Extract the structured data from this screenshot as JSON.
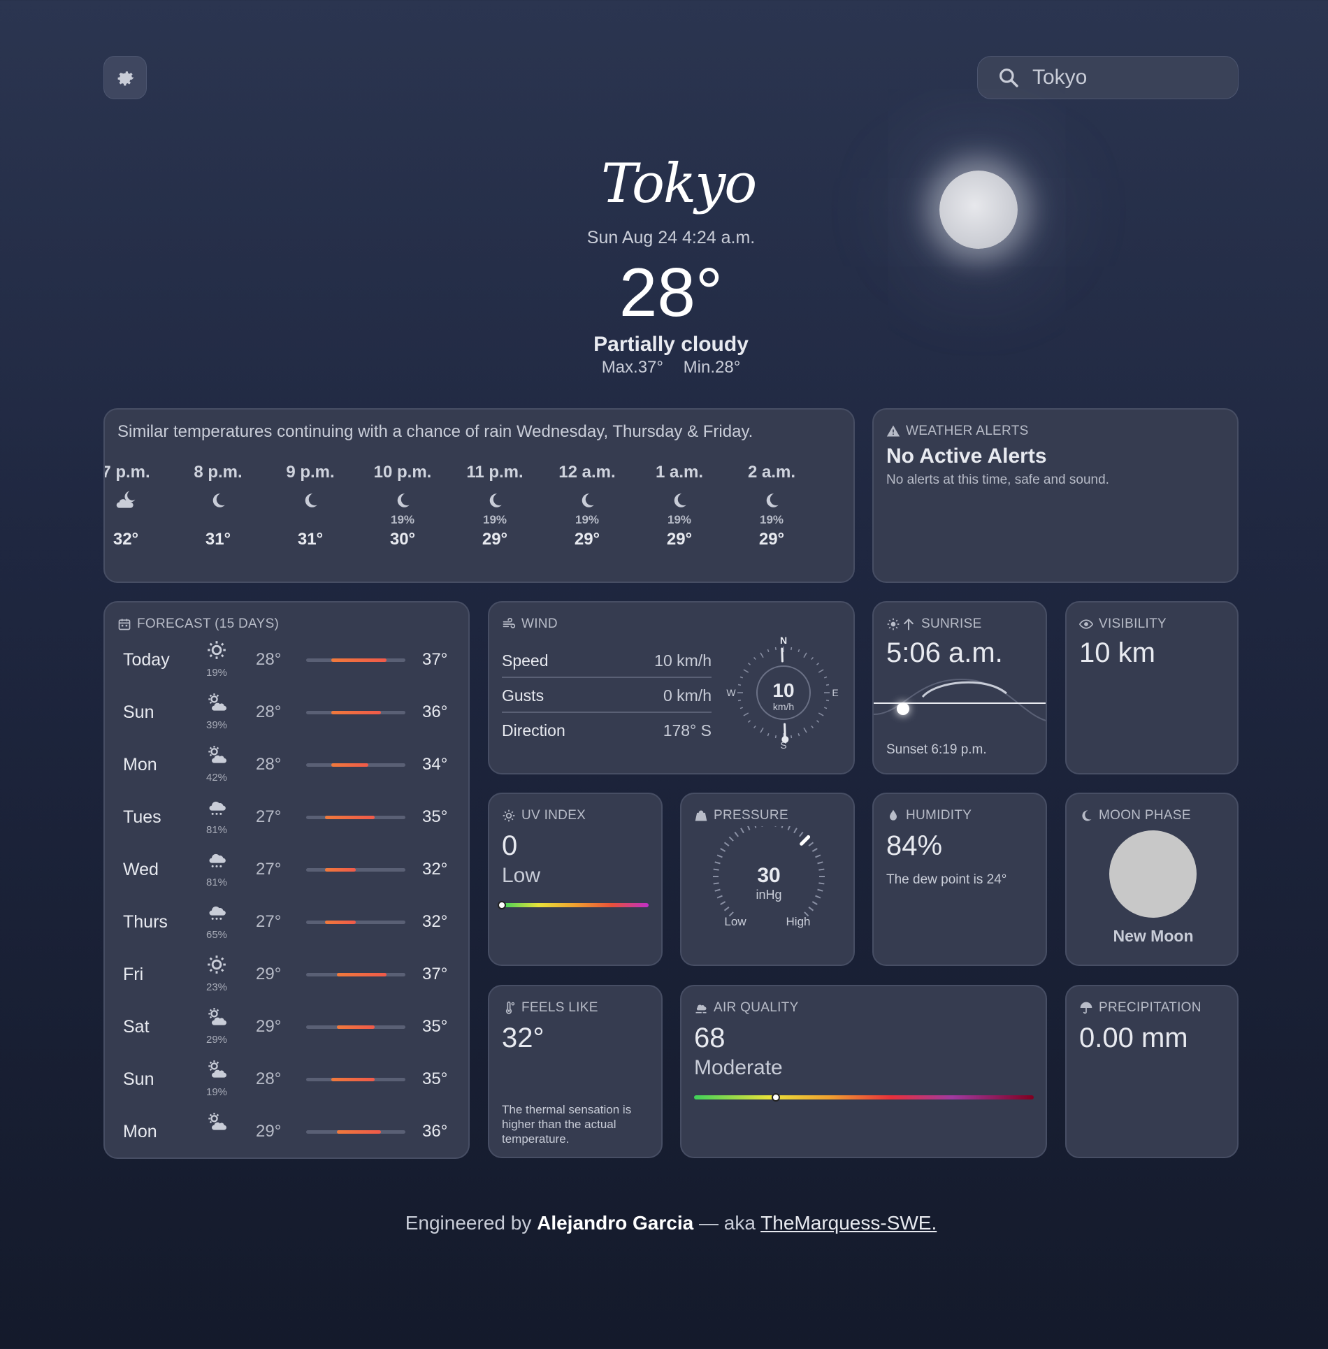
{
  "search": {
    "placeholder": "Tokyo"
  },
  "hero": {
    "city": "Tokyo",
    "datetime": "Sun Aug 24 4:24 a.m.",
    "temp": "28°",
    "condition": "Partially cloudy",
    "max": "Max.37°",
    "min": "Min.28°"
  },
  "hourly": {
    "summary": "Similar temperatures continuing with a chance of rain Wednesday, Thursday & Friday.",
    "items": [
      {
        "time": "7 p.m.",
        "icon": "moon-cloud-icon",
        "precip": "",
        "temp": "32°"
      },
      {
        "time": "8 p.m.",
        "icon": "moon-icon",
        "precip": "",
        "temp": "31°"
      },
      {
        "time": "9 p.m.",
        "icon": "moon-icon",
        "precip": "",
        "temp": "31°"
      },
      {
        "time": "10 p.m.",
        "icon": "moon-icon",
        "precip": "19%",
        "temp": "30°"
      },
      {
        "time": "11 p.m.",
        "icon": "moon-icon",
        "precip": "19%",
        "temp": "29°"
      },
      {
        "time": "12 a.m.",
        "icon": "moon-icon",
        "precip": "19%",
        "temp": "29°"
      },
      {
        "time": "1 a.m.",
        "icon": "moon-icon",
        "precip": "19%",
        "temp": "29°"
      },
      {
        "time": "2 a.m.",
        "icon": "moon-icon",
        "precip": "19%",
        "temp": "29°"
      }
    ]
  },
  "alerts": {
    "title": "WEATHER ALERTS",
    "heading": "No Active Alerts",
    "text": "No alerts at this time, safe and sound."
  },
  "forecast": {
    "title": "FORECAST (15 DAYS)",
    "days": [
      {
        "day": "Today",
        "icon": "sun-icon",
        "precip": "19%",
        "lo": "28°",
        "hi": "37°",
        "lo_val": 28,
        "hi_val": 37
      },
      {
        "day": "Sun",
        "icon": "sun-cloud-icon",
        "precip": "39%",
        "lo": "28°",
        "hi": "36°",
        "lo_val": 28,
        "hi_val": 36
      },
      {
        "day": "Mon",
        "icon": "sun-cloud-icon",
        "precip": "42%",
        "lo": "28°",
        "hi": "34°",
        "lo_val": 28,
        "hi_val": 34
      },
      {
        "day": "Tues",
        "icon": "rain-icon",
        "precip": "81%",
        "lo": "27°",
        "hi": "35°",
        "lo_val": 27,
        "hi_val": 35
      },
      {
        "day": "Wed",
        "icon": "rain-icon",
        "precip": "81%",
        "lo": "27°",
        "hi": "32°",
        "lo_val": 27,
        "hi_val": 32
      },
      {
        "day": "Thurs",
        "icon": "rain-icon",
        "precip": "65%",
        "lo": "27°",
        "hi": "32°",
        "lo_val": 27,
        "hi_val": 32
      },
      {
        "day": "Fri",
        "icon": "sun-icon",
        "precip": "23%",
        "lo": "29°",
        "hi": "37°",
        "lo_val": 29,
        "hi_val": 37
      },
      {
        "day": "Sat",
        "icon": "sun-cloud-icon",
        "precip": "29%",
        "lo": "29°",
        "hi": "35°",
        "lo_val": 29,
        "hi_val": 35
      },
      {
        "day": "Sun",
        "icon": "sun-cloud-icon",
        "precip": "19%",
        "lo": "28°",
        "hi": "35°",
        "lo_val": 28,
        "hi_val": 35
      },
      {
        "day": "Mon",
        "icon": "sun-cloud-icon",
        "precip": "",
        "lo": "29°",
        "hi": "36°",
        "lo_val": 29,
        "hi_val": 36
      }
    ]
  },
  "wind": {
    "title": "WIND",
    "speed_label": "Speed",
    "speed": "10 km/h",
    "gusts_label": "Gusts",
    "gusts": "0 km/h",
    "direction_label": "Direction",
    "direction": "178° S",
    "compass_value": "10",
    "compass_unit": "km/h",
    "n": "N",
    "e": "E",
    "s": "S",
    "w": "W",
    "direction_deg": 178
  },
  "sunrise": {
    "title": "SUNRISE",
    "time": "5:06 a.m.",
    "sunset": "Sunset 6:19 p.m."
  },
  "visibility": {
    "title": "VISIBILITY",
    "value": "10 km"
  },
  "uv": {
    "title": "UV INDEX",
    "value": "0",
    "level": "Low",
    "index_fraction": 0.0
  },
  "pressure": {
    "title": "PRESSURE",
    "value": "30",
    "unit": "inHg",
    "low": "Low",
    "high": "High"
  },
  "humidity": {
    "title": "HUMIDITY",
    "value": "84%",
    "text": "The dew point is 24°"
  },
  "moon_phase": {
    "title": "MOON PHASE",
    "phase": "New Moon"
  },
  "feels_like": {
    "title": "FEELS LIKE",
    "value": "32°",
    "text": "The thermal sensation is higher than the actual temperature."
  },
  "air_quality": {
    "title": "AIR QUALITY",
    "value": "68",
    "level": "Moderate",
    "index_fraction": 0.24
  },
  "precipitation": {
    "title": "PRECIPITATION",
    "value": "0.00 mm"
  },
  "footer": {
    "prefix": "Engineered by",
    "name": "Alejandro Garcia",
    "mid": "— aka",
    "link": "TheMarquess-SWE."
  },
  "colors": {
    "background": "#1f2740",
    "card": "#363c50",
    "accent_bar": "#f05a4a"
  }
}
